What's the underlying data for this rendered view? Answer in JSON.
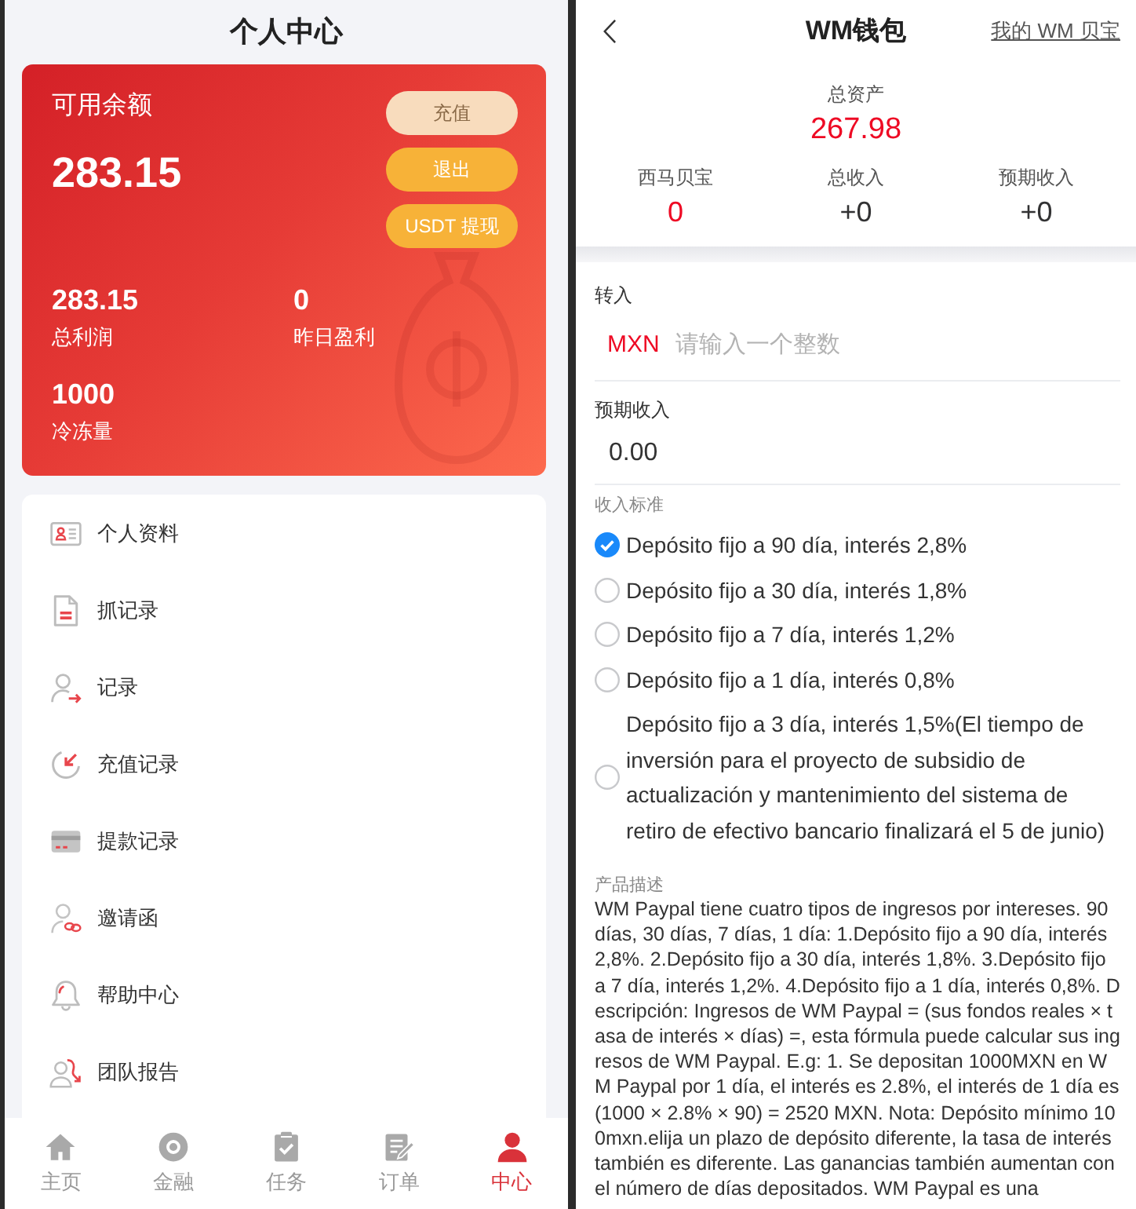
{
  "left_screen": {
    "title": "个人中心",
    "balance_card": {
      "label": "可用余额",
      "amount": "283.15",
      "buttons": [
        {
          "label": "充值",
          "kind": "light"
        },
        {
          "label": "退出",
          "kind": "accent"
        },
        {
          "label": "USDT 提现",
          "kind": "accent"
        }
      ],
      "stats": [
        {
          "value": "283.15",
          "label": "总利润"
        },
        {
          "value": "0",
          "label": "昨日盈利"
        },
        {
          "value": "1000",
          "label": "冷冻量"
        }
      ]
    },
    "menu": [
      "个人资料",
      "抓记录",
      "记录",
      "充值记录",
      "提款记录",
      "邀请函",
      "帮助中心",
      "团队报告"
    ],
    "tab_bar": [
      {
        "label": "主页",
        "selected": false
      },
      {
        "label": "金融",
        "selected": false
      },
      {
        "label": "任务",
        "selected": false
      },
      {
        "label": "订单",
        "selected": false
      },
      {
        "label": "中心",
        "selected": true
      }
    ]
  },
  "right_screen": {
    "title": "WM钱包",
    "header_link": "我的 WM 贝宝",
    "total_assets": {
      "label": "总资产",
      "value": "267.98"
    },
    "summary": [
      {
        "label": "西马贝宝",
        "value": "0",
        "color": "#ee0a24"
      },
      {
        "label": "总收入",
        "value": "+0",
        "color": "#323233"
      },
      {
        "label": "预期收入",
        "value": "+0",
        "color": "#323233"
      }
    ],
    "transfer_in": {
      "label": "转入",
      "currency": "MXN",
      "placeholder": "请输入一个整数"
    },
    "expected_income": {
      "label": "预期收入",
      "value": "0.00"
    },
    "income_standard": {
      "label": "收入标准",
      "options": [
        {
          "label": "Depósito fijo a 90 día, interés 2,8%",
          "selected": true
        },
        {
          "label": "Depósito fijo a 30 día, interés 1,8%",
          "selected": false
        },
        {
          "label": "Depósito fijo a 7 día, interés 1,2%",
          "selected": false
        },
        {
          "label": "Depósito fijo a 1 día, interés 0,8%",
          "selected": false
        },
        {
          "label": "Depósito fijo a 3 día, interés 1,5%(El tiempo de inversión para el proyecto de subsidio de actualización y mantenimiento del sistema de retiro de efectivo bancario finalizará el 5 de junio)",
          "selected": false
        }
      ]
    },
    "product_description": {
      "label": "产品描述",
      "text": "WM Paypal tiene cuatro tipos de ingresos por intereses. 90 días, 30 días, 7 días, 1 día: 1.Depósito fijo a 90 día, interés 2,8%. 2.Depósito fijo a 30 día, interés 1,8%. 3.Depósito fijo a 7 día, interés 1,2%. 4.Depósito fijo a 1 día, interés 0,8%. Descripción: Ingresos de WM Paypal = (sus fondos reales × tasa de interés × días) =, esta fórmula puede calcular sus ingresos de WM Paypal. E.g: 1. Se depositan 1000MXN en WM Paypal por 1 día, el interés es 2.8%, el interés de 1 día es (1000 × 2.8% × 90) = 2520 MXN. Nota: Depósito mínimo 100mxn.elija un plazo de depósito diferente, la tasa de interés también es diferente. Las ganancias también aumentan con el número de días depositados. WM Paypal es una"
    }
  }
}
